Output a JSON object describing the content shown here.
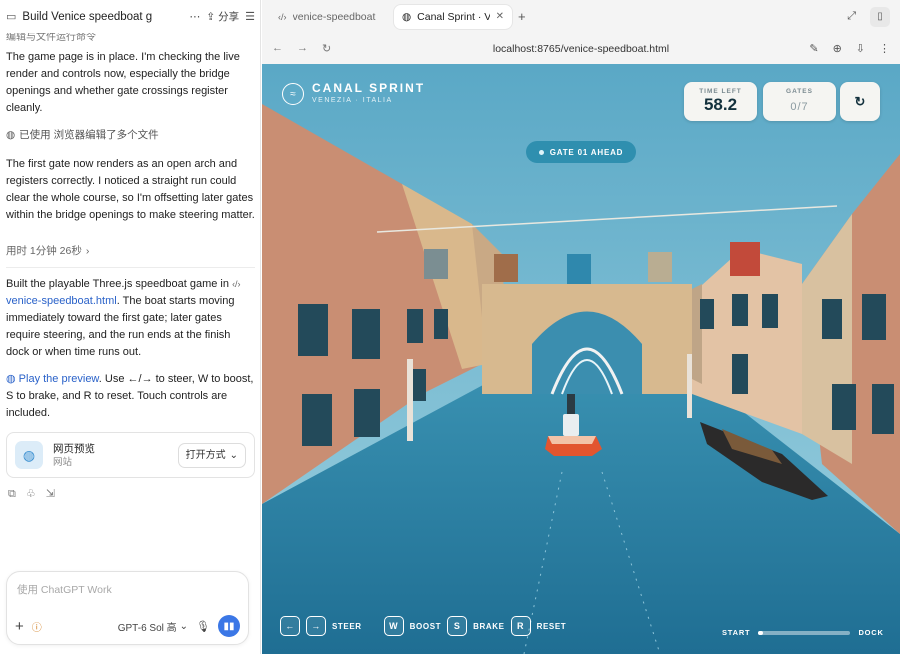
{
  "left": {
    "conversation_title": "Build Venice speedboat g",
    "share_label": "分享",
    "cut_line": "编辑与文件运行命令",
    "msg1": "The game page is in place. I'm checking the live render and controls now, especially the bridge openings and whether gate crossings register cleanly.",
    "tool_line": "已使用 浏览器编辑了多个文件",
    "msg2": "The first gate now renders as an open arch and registers correctly. I noticed a straight run could clear the whole course, so I'm offsetting later gates within the bridge openings to make steering matter.",
    "elapsed": "用时 1分钟 26秒",
    "msg3_a": "Built the playable Three.js speedboat game in",
    "msg3_file": "venice-speedboat.html",
    "msg3_b": ". The boat starts moving immediately toward the first gate; later gates require steering, and the run ends at the finish dock or when time runs out.",
    "msg4_link": "Play the preview",
    "msg4_b": ". Use ←/→ to steer, W to boost, S to brake, and R to reset. Touch controls are included.",
    "card_title": "网页预览",
    "card_sub": "网站",
    "card_open": "打开方式",
    "composer_placeholder": "使用 ChatGPT Work",
    "model_label": "GPT-6 Sol 高"
  },
  "browser": {
    "tab1": "venice-speedboat",
    "tab2": "Canal Sprint · V",
    "url": "localhost:8765/venice-speedboat.html"
  },
  "game": {
    "brand": "CANAL SPRINT",
    "subtitle": "VENEZIA · ITALIA",
    "time_label": "TIME LEFT",
    "time_value": "58.2",
    "gates_label": "GATES",
    "gates_value": "0/7",
    "reset_icon": "↻",
    "gate_banner": "GATE 01 AHEAD",
    "controls": {
      "left_key": "←",
      "right_key": "→",
      "steer": "STEER",
      "w_key": "W",
      "boost": "BOOST",
      "s_key": "S",
      "brake": "BRAKE",
      "r_key": "R",
      "reset": "RESET"
    },
    "progress_start": "START",
    "progress_end": "DOCK",
    "progress_fraction": 0.05
  },
  "colors": {
    "water": "#2f7ea2",
    "sky": "#6eb6cf",
    "accent": "#2f8faf",
    "boat": "#e2552f"
  }
}
